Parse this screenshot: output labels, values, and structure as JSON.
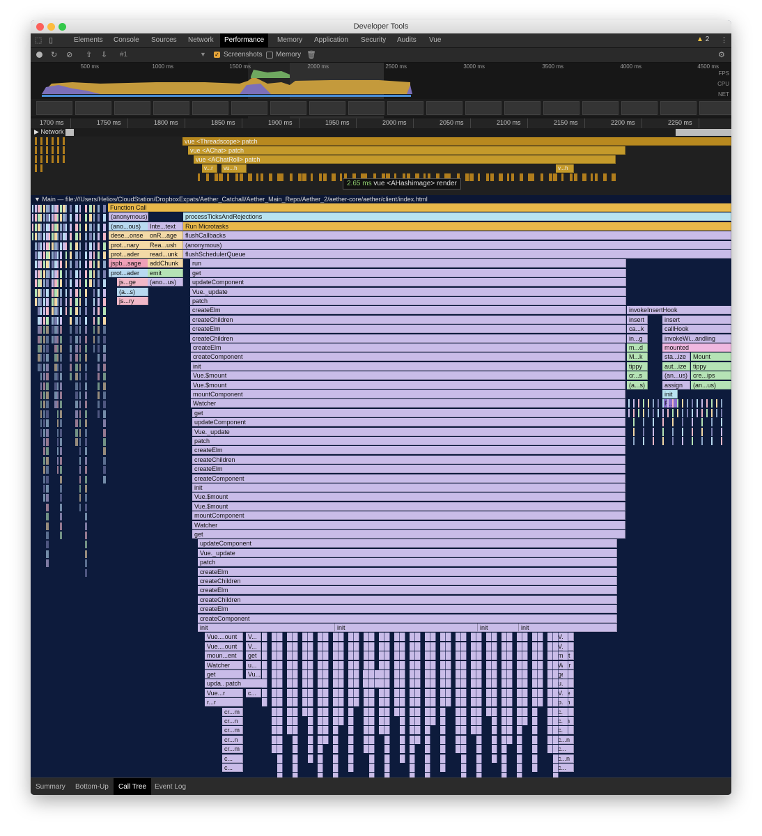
{
  "window": {
    "title": "Developer Tools"
  },
  "tabs": [
    {
      "label": "Elements"
    },
    {
      "label": "Console"
    },
    {
      "label": "Sources"
    },
    {
      "label": "Network"
    },
    {
      "label": "Performance",
      "selected": true
    },
    {
      "label": "Memory"
    },
    {
      "label": "Application"
    },
    {
      "label": "Security"
    },
    {
      "label": "Audits"
    },
    {
      "label": "Vue"
    }
  ],
  "warnings": {
    "count": "2"
  },
  "controls": {
    "recording": "#1",
    "screenshots_label": "Screenshots",
    "screenshots_checked": true,
    "memory_label": "Memory",
    "memory_checked": false
  },
  "overview": {
    "ticks": [
      "500 ms",
      "1000 ms",
      "1500 ms",
      "2000 ms",
      "2500 ms",
      "3000 ms",
      "3500 ms",
      "4000 ms",
      "4500 ms"
    ],
    "labels": [
      "FPS",
      "CPU",
      "NET"
    ]
  },
  "ruler": {
    "ticks": [
      "1700 ms",
      "1750 ms",
      "1800 ms",
      "1850 ms",
      "1900 ms",
      "1950 ms",
      "2000 ms",
      "2050 ms",
      "2100 ms",
      "2150 ms",
      "2200 ms",
      "2250 ms"
    ]
  },
  "network_label": "Network",
  "timings": {
    "bars": [
      "vue <Threadscope> patch",
      "vue <AChat> patch",
      "vue <AChatRoll> patch"
    ],
    "small": [
      "v...r",
      "vu...h",
      "v...h"
    ],
    "tooltip": {
      "duration": "2.65 ms",
      "text": "vue <AHashimage> render"
    }
  },
  "main_label": "Main — file:///Users/Helios/CloudStation/DropboxExpats/Aether_Catchall/Aether_Main_Repo/Aether_2/aether-core/aether/client/index.html",
  "flame": {
    "function_call": "Function Call",
    "left_labels": [
      "(anonymous)",
      "(ano...ous)",
      "dese...onse",
      "prot...nary",
      "prot...ader",
      "jspb...sage",
      "prot...ader",
      "js...ge",
      "(a...s)",
      "js...ry"
    ],
    "left2_labels": [
      "Inte...text",
      "onR...age",
      "Rea...ush",
      "read...unk",
      "addChunk",
      "emit",
      "(ano...us)"
    ],
    "main_stack": [
      "processTicksAndRejections",
      "Run Microtasks",
      "flushCallbacks",
      "(anonymous)",
      "flushSchedulerQueue",
      "run",
      "get",
      "updateComponent",
      "Vue._update",
      "patch",
      "createElm",
      "createChildren",
      "createElm",
      "createChildren",
      "createElm",
      "createComponent",
      "init",
      "Vue.$mount",
      "Vue.$mount",
      "mountComponent",
      "Watcher",
      "get",
      "updateComponent",
      "Vue._update",
      "patch",
      "createElm",
      "createChildren",
      "createElm",
      "createComponent",
      "init",
      "Vue.$mount",
      "Vue.$mount",
      "mountComponent",
      "Watcher",
      "get",
      "updateComponent",
      "Vue._update",
      "patch",
      "createElm",
      "createChildren",
      "createElm",
      "createChildren",
      "createElm",
      "createComponent"
    ],
    "deep_inits": [
      "init",
      "init",
      "init",
      "init"
    ],
    "deep_col_a": [
      "Vue....ount",
      "Vue....ount",
      "moun...ent",
      "Watcher",
      "get",
      "upda...nent",
      "Vue...r",
      "r...r",
      "cr...m",
      "cr...n",
      "cr...m",
      "cr...n",
      "cr...m",
      "c...",
      "c..."
    ],
    "deep_col_b": [
      "V...",
      "V...",
      "get",
      "u...",
      "Vu...e",
      "patch",
      "c..."
    ],
    "deep_col_c": [
      "get",
      "u..."
    ],
    "deep_col_d": [
      "V...t",
      "V...t",
      "m...t",
      "W...r",
      "get",
      "u...t",
      "V...e",
      "p...h",
      "c...",
      "c...n",
      "c...",
      "c...n",
      "c...",
      "c...n",
      "c..."
    ],
    "right_hook": "invokeInsertHook",
    "right_a": [
      "insert",
      "ca...k",
      "in...g",
      "m...d",
      "M...k",
      "tippy",
      "cr...s",
      "(a...s)"
    ],
    "right_b": [
      "insert",
      "callHook",
      "invokeWi...andling",
      "mounted",
      "sta...ize",
      "aut...ize",
      "(an...us)",
      "assign",
      "init",
      "R..."
    ],
    "right_c": [
      "Mount",
      "tippy",
      "cre...ips",
      "(an...us)"
    ]
  },
  "bottom_tabs": [
    {
      "label": "Summary"
    },
    {
      "label": "Bottom-Up"
    },
    {
      "label": "Call Tree",
      "selected": true
    },
    {
      "label": "Event Log"
    }
  ]
}
